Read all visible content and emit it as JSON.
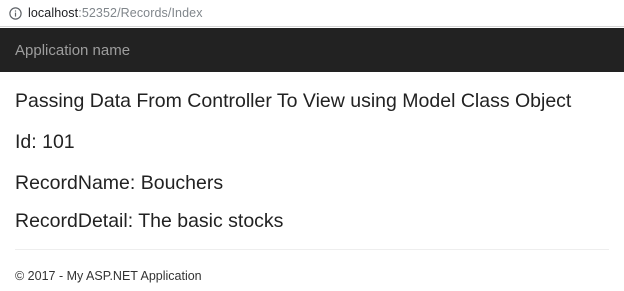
{
  "browser": {
    "url_host": "localhost",
    "url_rest": ":52352/Records/Index",
    "info_icon": "info-icon"
  },
  "navbar": {
    "brand": "Application name",
    "background": "#222222",
    "brand_color": "#9d9d9d"
  },
  "main": {
    "heading": "Passing Data From Controller To View using Model Class Object",
    "id_line": "Id: 101",
    "record_name_line": "RecordName: Bouchers",
    "record_detail_line": "RecordDetail: The basic stocks"
  },
  "footer": {
    "text": "© 2017 - My ASP.NET Application"
  }
}
